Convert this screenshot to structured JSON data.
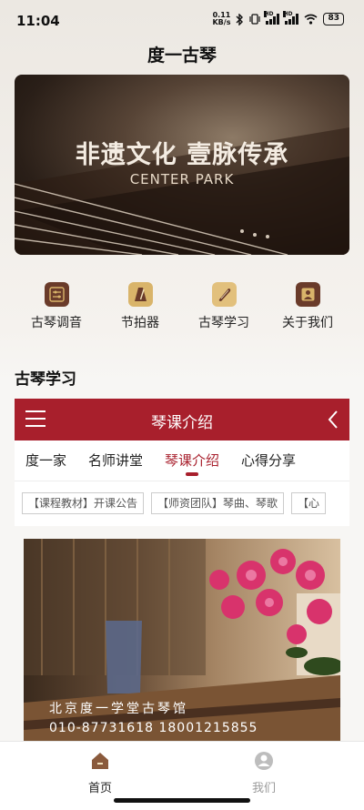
{
  "status_bar": {
    "time": "11:04",
    "net_speed_value": "0.11",
    "net_speed_unit": "KB/s",
    "hd1": "HD",
    "hd2": "HD",
    "battery": "83"
  },
  "page": {
    "title": "度一古琴"
  },
  "banner": {
    "title": "非遗文化 壹脉传承",
    "subtitle": "CENTER PARK"
  },
  "quick_menu": [
    {
      "label": "古琴调音",
      "icon": "tuner-icon"
    },
    {
      "label": "节拍器",
      "icon": "metronome-icon"
    },
    {
      "label": "古琴学习",
      "icon": "guqin-icon"
    },
    {
      "label": "关于我们",
      "icon": "contact-icon"
    }
  ],
  "section": {
    "title": "古琴学习"
  },
  "embedded_header": {
    "title": "琴课介绍"
  },
  "tabs": [
    "度一家",
    "名师讲堂",
    "琴课介绍",
    "心得分享"
  ],
  "active_tab": "琴课介绍",
  "chips": [
    "【课程教材】开课公告",
    "【师资团队】琴曲、琴歌",
    "【心"
  ],
  "photo": {
    "caption_line1": "北京度一学堂古琴馆",
    "caption_line2": "010-87731618  18001215855"
  },
  "bottom_nav": [
    {
      "label": "首页",
      "icon": "home-icon",
      "active": true
    },
    {
      "label": "我们",
      "icon": "user-icon",
      "active": false
    }
  ],
  "colors": {
    "accent": "#a81f2c",
    "icon_brown": "#6a3b2a",
    "icon_gold": "#d9b46a"
  }
}
